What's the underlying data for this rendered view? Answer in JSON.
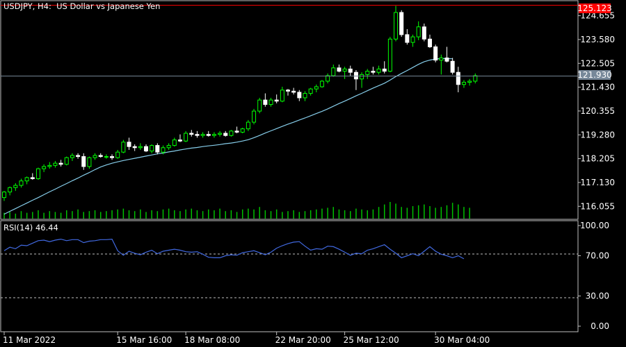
{
  "window": {
    "symbol_title": "USDJPY, H4:  US Dollar vs Japanese Yen",
    "indicator_title": "RSI(14) 46.44"
  },
  "colors": {
    "background": "#000000",
    "frame": "#c0c0c0",
    "bull_candle": "#00ff00",
    "bear_candle": "#ffffff",
    "moving_average": "#87ceeb",
    "volume": "#00c000",
    "bid_line": "#778899",
    "ask_line": "#ff0000",
    "rsi_line": "#4169e1",
    "rsi_levels": "#c0c0c0",
    "ask_tag": "#ff0000",
    "bid_tag": "#778899"
  },
  "price_tags": {
    "ask": "125.123",
    "bid": "121.930"
  },
  "chart_data": [
    {
      "type": "candlestick",
      "title": "USDJPY, H4:  US Dollar vs Japanese Yen",
      "y_ticks": [
        "124.655",
        "123.580",
        "122.505",
        "121.430",
        "120.355",
        "119.280",
        "118.205",
        "117.130",
        "116.055"
      ],
      "ylim": [
        115.5,
        125.3
      ],
      "x_ticks": [
        {
          "label": "11 Mar 2022",
          "index": 0
        },
        {
          "label": "15 Mar 16:00",
          "index": 20
        },
        {
          "label": "18 Mar 08:00",
          "index": 32
        },
        {
          "label": "22 Mar 20:00",
          "index": 48
        },
        {
          "label": "25 Mar 12:00",
          "index": 60
        },
        {
          "label": "30 Mar 04:00",
          "index": 76
        }
      ],
      "candles": [
        [
          116.45,
          116.75,
          116.3,
          116.7
        ],
        [
          116.7,
          116.95,
          116.55,
          116.9
        ],
        [
          116.9,
          117.1,
          116.75,
          117.0
        ],
        [
          117.0,
          117.3,
          116.9,
          117.2
        ],
        [
          117.2,
          117.4,
          117.05,
          117.35
        ],
        [
          117.35,
          117.55,
          117.25,
          117.3
        ],
        [
          117.3,
          117.8,
          117.25,
          117.75
        ],
        [
          117.75,
          117.95,
          117.6,
          117.85
        ],
        [
          117.85,
          118.05,
          117.75,
          117.9
        ],
        [
          117.9,
          118.1,
          117.8,
          118.0
        ],
        [
          118.0,
          118.15,
          117.85,
          117.95
        ],
        [
          117.95,
          118.3,
          117.9,
          118.25
        ],
        [
          118.25,
          118.45,
          118.1,
          118.35
        ],
        [
          118.35,
          118.45,
          118.2,
          118.3
        ],
        [
          118.3,
          118.45,
          117.7,
          117.85
        ],
        [
          117.85,
          118.3,
          117.75,
          118.25
        ],
        [
          118.25,
          118.45,
          118.15,
          118.35
        ],
        [
          118.35,
          118.45,
          118.25,
          118.3
        ],
        [
          118.3,
          118.4,
          118.2,
          118.3
        ],
        [
          118.3,
          118.4,
          118.15,
          118.25
        ],
        [
          118.25,
          118.6,
          118.2,
          118.5
        ],
        [
          118.5,
          119.05,
          118.45,
          118.95
        ],
        [
          118.95,
          119.15,
          118.6,
          118.75
        ],
        [
          118.75,
          118.85,
          118.55,
          118.7
        ],
        [
          118.7,
          118.9,
          118.6,
          118.75
        ],
        [
          118.75,
          118.85,
          118.5,
          118.55
        ],
        [
          118.55,
          118.85,
          118.45,
          118.8
        ],
        [
          118.8,
          118.9,
          118.4,
          118.5
        ],
        [
          118.5,
          118.8,
          118.4,
          118.7
        ],
        [
          118.7,
          118.9,
          118.6,
          118.8
        ],
        [
          118.8,
          119.15,
          118.75,
          119.05
        ],
        [
          119.05,
          119.3,
          118.95,
          119.0
        ],
        [
          119.0,
          119.45,
          118.95,
          119.35
        ],
        [
          119.35,
          119.5,
          119.2,
          119.3
        ],
        [
          119.3,
          119.45,
          119.15,
          119.25
        ],
        [
          119.25,
          119.4,
          119.15,
          119.3
        ],
        [
          119.3,
          119.45,
          119.2,
          119.25
        ],
        [
          119.25,
          119.4,
          119.15,
          119.3
        ],
        [
          119.3,
          119.45,
          119.2,
          119.35
        ],
        [
          119.35,
          119.45,
          119.2,
          119.25
        ],
        [
          119.25,
          119.5,
          119.2,
          119.45
        ],
        [
          119.45,
          119.65,
          119.35,
          119.4
        ],
        [
          119.4,
          119.6,
          119.35,
          119.55
        ],
        [
          119.55,
          119.95,
          119.45,
          119.85
        ],
        [
          119.85,
          120.45,
          119.75,
          120.35
        ],
        [
          120.35,
          120.95,
          120.25,
          120.85
        ],
        [
          120.85,
          121.15,
          120.55,
          120.65
        ],
        [
          120.65,
          120.95,
          120.55,
          120.85
        ],
        [
          120.85,
          121.1,
          120.7,
          120.8
        ],
        [
          120.8,
          121.45,
          120.75,
          121.3
        ],
        [
          121.3,
          121.35,
          121.05,
          121.25
        ],
        [
          121.25,
          121.4,
          121.1,
          121.2
        ],
        [
          121.2,
          121.3,
          120.8,
          120.95
        ],
        [
          120.95,
          121.25,
          120.8,
          121.15
        ],
        [
          121.15,
          121.4,
          121.05,
          121.35
        ],
        [
          121.35,
          121.55,
          121.2,
          121.45
        ],
        [
          121.45,
          121.75,
          121.4,
          121.7
        ],
        [
          121.7,
          122.05,
          121.6,
          121.95
        ],
        [
          121.95,
          122.45,
          121.9,
          122.3
        ],
        [
          122.3,
          122.45,
          122.1,
          122.15
        ],
        [
          122.15,
          122.35,
          121.8,
          122.25
        ],
        [
          122.25,
          122.4,
          121.95,
          122.1
        ],
        [
          122.1,
          122.2,
          121.3,
          121.8
        ],
        [
          121.8,
          122.1,
          121.4,
          122.0
        ],
        [
          122.0,
          122.25,
          121.8,
          122.15
        ],
        [
          122.15,
          122.35,
          122.0,
          122.1
        ],
        [
          122.1,
          122.4,
          122.0,
          122.25
        ],
        [
          122.25,
          122.6,
          122.05,
          122.15
        ],
        [
          122.15,
          123.7,
          122.1,
          123.6
        ],
        [
          123.6,
          125.1,
          123.5,
          124.8
        ],
        [
          124.8,
          124.9,
          123.7,
          123.8
        ],
        [
          123.8,
          124.05,
          123.35,
          123.45
        ],
        [
          123.45,
          123.8,
          123.25,
          123.7
        ],
        [
          123.7,
          124.4,
          123.55,
          124.15
        ],
        [
          124.15,
          124.3,
          123.5,
          123.6
        ],
        [
          123.6,
          123.8,
          123.2,
          123.25
        ],
        [
          123.25,
          123.35,
          122.55,
          122.65
        ],
        [
          122.65,
          122.9,
          122.0,
          122.75
        ],
        [
          122.75,
          123.25,
          122.55,
          122.6
        ],
        [
          122.6,
          122.75,
          122.0,
          122.1
        ],
        [
          122.1,
          122.35,
          121.2,
          121.55
        ],
        [
          121.55,
          121.75,
          121.4,
          121.65
        ],
        [
          121.65,
          121.8,
          121.5,
          121.7
        ],
        [
          121.7,
          122.05,
          121.6,
          121.95
        ]
      ],
      "moving_average": [
        115.7,
        115.83,
        115.95,
        116.08,
        116.2,
        116.33,
        116.45,
        116.58,
        116.71,
        116.83,
        116.96,
        117.08,
        117.21,
        117.33,
        117.46,
        117.58,
        117.71,
        117.83,
        117.92,
        118.0,
        118.06,
        118.12,
        118.17,
        118.22,
        118.27,
        118.32,
        118.37,
        118.42,
        118.46,
        118.51,
        118.55,
        118.6,
        118.64,
        118.68,
        118.71,
        118.75,
        118.78,
        118.81,
        118.84,
        118.88,
        118.91,
        118.95,
        119.0,
        119.06,
        119.15,
        119.25,
        119.36,
        119.46,
        119.56,
        119.66,
        119.76,
        119.85,
        119.95,
        120.04,
        120.14,
        120.24,
        120.34,
        120.45,
        120.57,
        120.69,
        120.8,
        120.92,
        121.04,
        121.15,
        121.27,
        121.39,
        121.5,
        121.61,
        121.75,
        121.91,
        122.05,
        122.18,
        122.32,
        122.46,
        122.58,
        122.65,
        122.7,
        122.72,
        122.72,
        122.71
      ],
      "volume": [
        0.35,
        0.4,
        0.3,
        0.45,
        0.35,
        0.4,
        0.5,
        0.35,
        0.45,
        0.4,
        0.35,
        0.5,
        0.45,
        0.55,
        0.4,
        0.45,
        0.5,
        0.4,
        0.45,
        0.5,
        0.55,
        0.6,
        0.5,
        0.45,
        0.55,
        0.4,
        0.5,
        0.45,
        0.55,
        0.6,
        0.5,
        0.45,
        0.55,
        0.6,
        0.5,
        0.45,
        0.55,
        0.5,
        0.6,
        0.45,
        0.5,
        0.4,
        0.55,
        0.6,
        0.55,
        0.7,
        0.5,
        0.45,
        0.55,
        0.4,
        0.45,
        0.5,
        0.4,
        0.45,
        0.5,
        0.55,
        0.6,
        0.65,
        0.7,
        0.55,
        0.5,
        0.45,
        0.6,
        0.55,
        0.5,
        0.55,
        0.7,
        0.85,
        1.0,
        0.9,
        0.7,
        0.65,
        0.75,
        0.8,
        0.85,
        0.75,
        0.65,
        0.7,
        0.8,
        0.95,
        0.85,
        0.7,
        0.65
      ],
      "bid": 121.93,
      "ask": 125.123
    },
    {
      "type": "line",
      "title": "RSI(14) 46.44",
      "y_ticks": [
        "100.00",
        "70.00",
        "30.00",
        "0.00"
      ],
      "ylim": [
        0,
        100
      ],
      "levels": [
        70,
        30
      ],
      "values": [
        75.0,
        78.5,
        77.0,
        80.5,
        80.0,
        82.5,
        85.0,
        85.5,
        84.0,
        85.5,
        86.5,
        85.0,
        86.0,
        86.0,
        83.0,
        84.5,
        85.0,
        86.0,
        86.0,
        86.5,
        75.0,
        70.5,
        74.5,
        72.5,
        71.0,
        73.5,
        75.5,
        72.0,
        74.5,
        75.5,
        76.5,
        75.5,
        74.0,
        73.5,
        74.0,
        71.5,
        68.5,
        68.0,
        68.0,
        70.0,
        71.0,
        70.5,
        73.0,
        74.0,
        75.0,
        73.0,
        71.0,
        73.5,
        77.5,
        80.0,
        82.0,
        83.5,
        84.0,
        79.5,
        75.5,
        77.0,
        76.5,
        79.5,
        79.0,
        76.5,
        73.5,
        70.5,
        72.5,
        72.0,
        75.5,
        77.0,
        79.0,
        81.0,
        76.5,
        72.5,
        68.0,
        70.0,
        72.0,
        70.0,
        74.5,
        79.0,
        74.5,
        71.5,
        70.0,
        68.0,
        70.0,
        67.0
      ]
    }
  ]
}
